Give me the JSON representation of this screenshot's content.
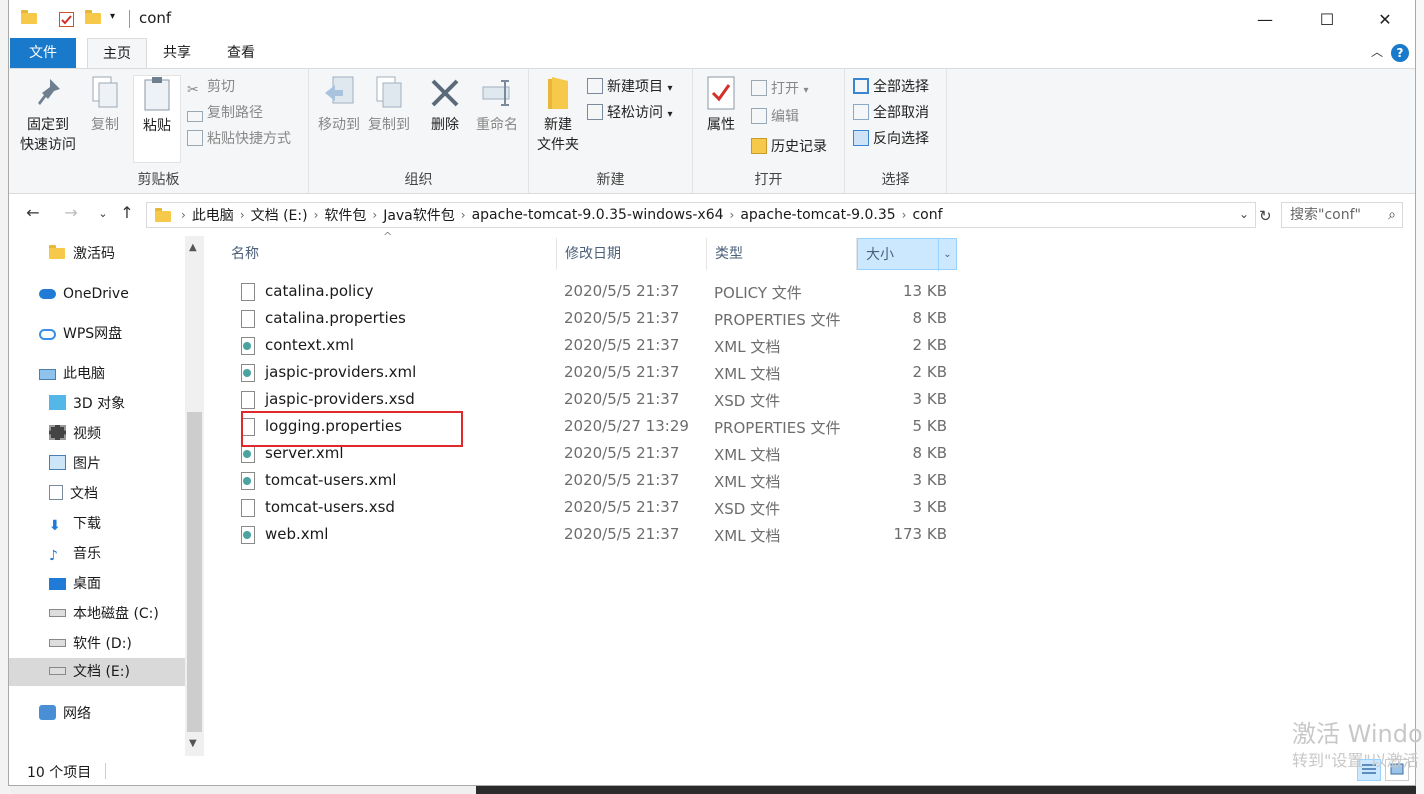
{
  "window": {
    "title": "conf",
    "controls": {
      "minimize": "—",
      "maximize": "☐",
      "close": "✕"
    }
  },
  "tabs": {
    "file": "文件",
    "home": "主页",
    "share": "共享",
    "view": "查看",
    "help": "?"
  },
  "ribbon": {
    "clipboard": {
      "label": "剪贴板",
      "pin_line1": "固定到",
      "pin_line2": "快速访问",
      "copy": "复制",
      "paste": "粘贴",
      "cut": "剪切",
      "copy_path": "复制路径",
      "paste_shortcut": "粘贴快捷方式"
    },
    "organize": {
      "label": "组织",
      "move_to": "移动到",
      "copy_to": "复制到",
      "delete": "删除",
      "rename": "重命名"
    },
    "new": {
      "label": "新建",
      "new_folder_line1": "新建",
      "new_folder_line2": "文件夹",
      "new_item": "新建项目",
      "easy_access": "轻松访问"
    },
    "open": {
      "label": "打开",
      "properties": "属性",
      "open": "打开",
      "edit": "编辑",
      "history": "历史记录"
    },
    "select": {
      "label": "选择",
      "select_all": "全部选择",
      "select_none": "全部取消",
      "invert": "反向选择"
    }
  },
  "address": {
    "crumbs": [
      "此电脑",
      "文档 (E:)",
      "软件包",
      "Java软件包",
      "apache-tomcat-9.0.35-windows-x64",
      "apache-tomcat-9.0.35",
      "conf"
    ],
    "search_placeholder": "搜索\"conf\""
  },
  "nav": {
    "items": [
      {
        "label": "激活码",
        "icon": "folder-icon"
      },
      {
        "label": "OneDrive",
        "icon": "onedrive-icon"
      },
      {
        "label": "WPS网盘",
        "icon": "wps-cloud-icon"
      },
      {
        "label": "此电脑",
        "icon": "computer-icon"
      },
      {
        "label": "3D 对象",
        "icon": "3d-objects-icon"
      },
      {
        "label": "视频",
        "icon": "video-icon"
      },
      {
        "label": "图片",
        "icon": "pictures-icon"
      },
      {
        "label": "文档",
        "icon": "documents-icon"
      },
      {
        "label": "下载",
        "icon": "download-icon"
      },
      {
        "label": "音乐",
        "icon": "music-icon"
      },
      {
        "label": "桌面",
        "icon": "desktop-icon"
      },
      {
        "label": "本地磁盘 (C:)",
        "icon": "drive-c-icon"
      },
      {
        "label": "软件 (D:)",
        "icon": "drive-d-icon"
      },
      {
        "label": "文档 (E:)",
        "icon": "drive-e-icon"
      },
      {
        "label": "网络",
        "icon": "network-icon"
      }
    ],
    "selected": "文档 (E:)"
  },
  "columns": {
    "name": "名称",
    "date": "修改日期",
    "type": "类型",
    "size": "大小"
  },
  "files": [
    {
      "name": "catalina.policy",
      "date": "2020/5/5 21:37",
      "type": "POLICY 文件",
      "size": "13 KB",
      "icon": "file-icon"
    },
    {
      "name": "catalina.properties",
      "date": "2020/5/5 21:37",
      "type": "PROPERTIES 文件",
      "size": "8 KB",
      "icon": "file-icon"
    },
    {
      "name": "context.xml",
      "date": "2020/5/5 21:37",
      "type": "XML 文档",
      "size": "2 KB",
      "icon": "xml-file-icon"
    },
    {
      "name": "jaspic-providers.xml",
      "date": "2020/5/5 21:37",
      "type": "XML 文档",
      "size": "2 KB",
      "icon": "xml-file-icon"
    },
    {
      "name": "jaspic-providers.xsd",
      "date": "2020/5/5 21:37",
      "type": "XSD 文件",
      "size": "3 KB",
      "icon": "file-icon"
    },
    {
      "name": "logging.properties",
      "date": "2020/5/27 13:29",
      "type": "PROPERTIES 文件",
      "size": "5 KB",
      "icon": "file-icon"
    },
    {
      "name": "server.xml",
      "date": "2020/5/5 21:37",
      "type": "XML 文档",
      "size": "8 KB",
      "icon": "xml-file-icon"
    },
    {
      "name": "tomcat-users.xml",
      "date": "2020/5/5 21:37",
      "type": "XML 文档",
      "size": "3 KB",
      "icon": "xml-file-icon"
    },
    {
      "name": "tomcat-users.xsd",
      "date": "2020/5/5 21:37",
      "type": "XSD 文件",
      "size": "3 KB",
      "icon": "file-icon"
    },
    {
      "name": "web.xml",
      "date": "2020/5/5 21:37",
      "type": "XML 文档",
      "size": "173 KB",
      "icon": "xml-file-icon"
    }
  ],
  "highlighted_file": "logging.properties",
  "status": {
    "count": "10 个项目"
  },
  "watermark": {
    "line1": "激活 Windo",
    "line2": "转到\"设置\"以激活"
  },
  "colors": {
    "accent": "#1979ca",
    "highlight_box": "#e0292b",
    "selection": "#cce8ff"
  }
}
